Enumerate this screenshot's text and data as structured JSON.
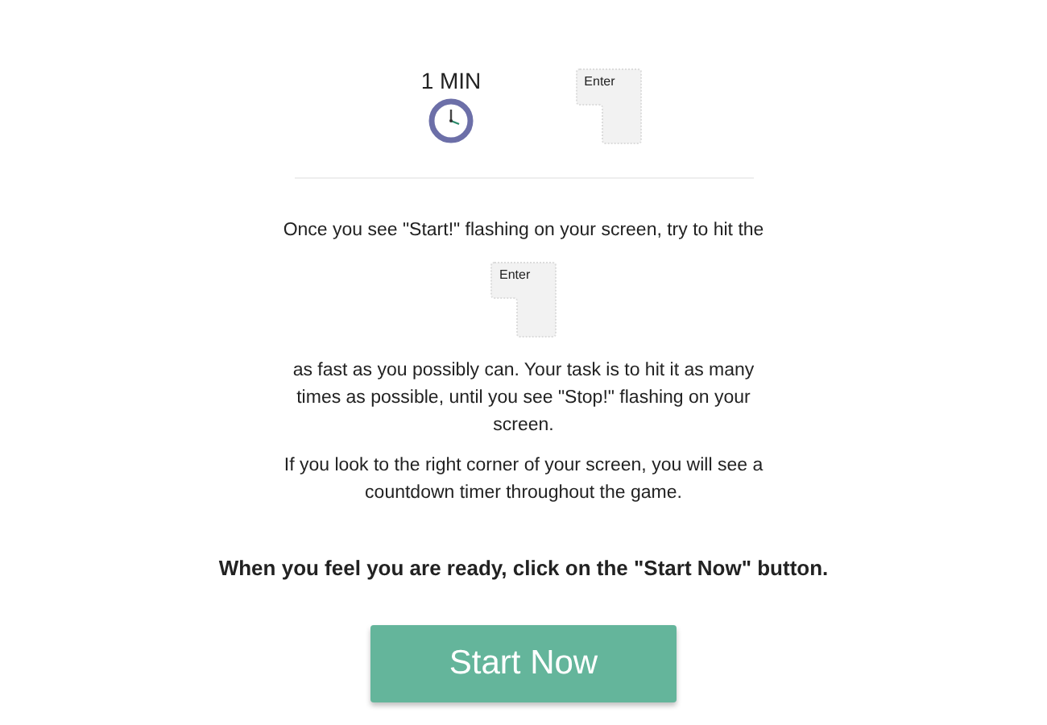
{
  "timer": {
    "label": "1 MIN"
  },
  "top_key": {
    "label": "Enter"
  },
  "instructions": [
    "Once you see \"Start!\" flashing on your screen, try to hit the"
  ],
  "inline_key": {
    "label": "Enter"
  },
  "after": [
    "as fast as you possibly can. Your task is to hit it as many times as possible, until you see \"Stop!\" flashing on your screen.",
    "If you look to the right corner of your screen, you will see a countdown timer throughout the game."
  ],
  "prompt": "When you feel you are ready, click on the \"Start Now\" button.",
  "button": {
    "label": "Start Now"
  }
}
